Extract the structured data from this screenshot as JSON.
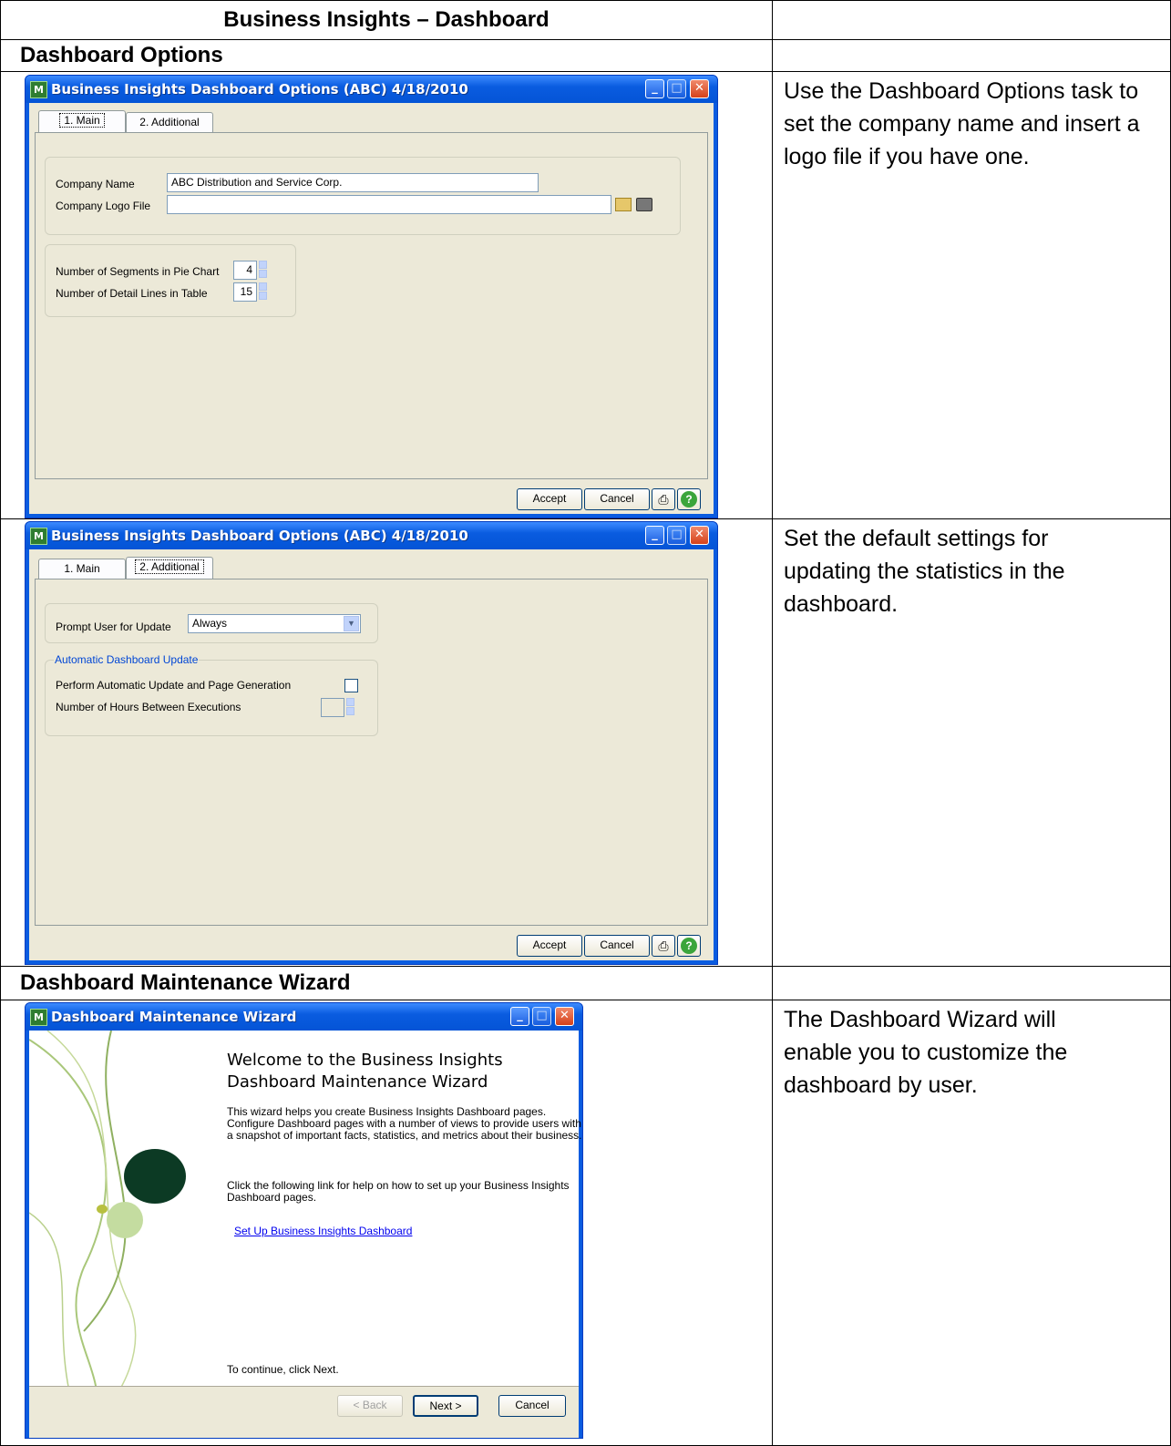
{
  "table": {
    "header": "Business Insights – Dashboard",
    "section1": "Dashboard Options",
    "section2": "Dashboard Maintenance Wizard",
    "desc1": "Use the Dashboard Options task to set the company name and insert a logo file if you have one.",
    "desc2": "Set the default settings for updating the statistics in the dashboard.",
    "desc3": "The Dashboard Wizard will enable you to customize the dashboard by user."
  },
  "options_window": {
    "title": "Business Insights Dashboard Options (ABC) 4/18/2010",
    "tab_main": "1. Main",
    "tab_additional": "2. Additional",
    "company_name_label": "Company Name",
    "company_name_value": "ABC Distribution and Service Corp.",
    "logo_label": "Company Logo File",
    "logo_value": "",
    "segments_label": "Number of Segments in Pie Chart",
    "segments_value": "4",
    "detail_lines_label": "Number of Detail Lines in Table",
    "detail_lines_value": "15",
    "accept": "Accept",
    "cancel": "Cancel"
  },
  "additional_window": {
    "title": "Business Insights Dashboard Options (ABC) 4/18/2010",
    "tab_main": "1. Main",
    "tab_additional": "2. Additional",
    "prompt_label": "Prompt User for Update",
    "prompt_value": "Always",
    "group_title": "Automatic Dashboard Update",
    "auto_update_label": "Perform Automatic Update and Page Generation",
    "hours_label": "Number of Hours Between Executions",
    "hours_value": "",
    "accept": "Accept",
    "cancel": "Cancel"
  },
  "wizard_window": {
    "title": "Dashboard Maintenance Wizard",
    "welcome_line1": "Welcome to the Business Insights",
    "welcome_line2": "Dashboard Maintenance Wizard",
    "para1": "This wizard helps you create Business Insights Dashboard pages. Configure Dashboard pages with a number of views to provide users with a snapshot of important facts, statistics, and metrics about their business.",
    "para2": "Click the following link for help on how to set up your Business Insights Dashboard pages.",
    "link": "Set Up Business Insights Dashboard",
    "continue": "To continue, click Next.",
    "back": "< Back",
    "next": "Next >",
    "cancel": "Cancel"
  },
  "colors": {
    "title_blue": "#0a5ce0",
    "dialog_bg": "#ece9d8",
    "link": "#0000ee"
  }
}
